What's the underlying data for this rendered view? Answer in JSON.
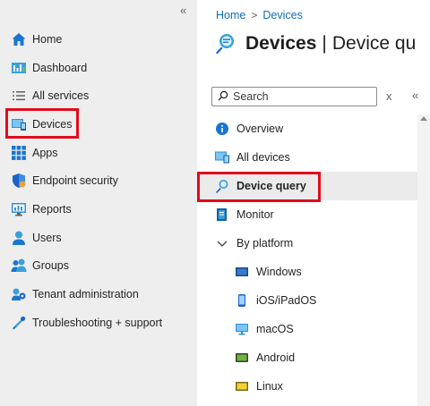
{
  "leftnav": {
    "collapse_icon": "double-chevron-left",
    "items": [
      {
        "label": "Home",
        "icon": "home-icon"
      },
      {
        "label": "Dashboard",
        "icon": "dashboard-icon"
      },
      {
        "label": "All services",
        "icon": "list-icon"
      },
      {
        "label": "Devices",
        "icon": "devices-icon"
      },
      {
        "label": "Apps",
        "icon": "apps-grid-icon"
      },
      {
        "label": "Endpoint security",
        "icon": "shield-icon"
      },
      {
        "label": "Reports",
        "icon": "reports-icon"
      },
      {
        "label": "Users",
        "icon": "user-icon"
      },
      {
        "label": "Groups",
        "icon": "groups-icon"
      },
      {
        "label": "Tenant administration",
        "icon": "tenant-gear-icon"
      },
      {
        "label": "Troubleshooting + support",
        "icon": "tools-icon"
      }
    ]
  },
  "breadcrumb": {
    "home": "Home",
    "separator": ">",
    "current": "Devices"
  },
  "page": {
    "title_bold": "Devices",
    "title_sep": "|",
    "title_rest": "Device qu"
  },
  "search": {
    "placeholder": "Search",
    "clear": "x",
    "collapse": "«"
  },
  "menu": {
    "items": [
      {
        "label": "Overview",
        "icon": "info-icon"
      },
      {
        "label": "All devices",
        "icon": "all-devices-icon"
      },
      {
        "label": "Device query",
        "icon": "device-query-icon",
        "selected": true
      },
      {
        "label": "Monitor",
        "icon": "monitor-book-icon"
      },
      {
        "label": "By platform",
        "icon": "chevron-down-icon"
      },
      {
        "label": "Windows",
        "icon": "windows-icon"
      },
      {
        "label": "iOS/iPadOS",
        "icon": "phone-icon"
      },
      {
        "label": "macOS",
        "icon": "desktop-icon"
      },
      {
        "label": "Android",
        "icon": "android-icon"
      },
      {
        "label": "Linux",
        "icon": "linux-icon"
      }
    ]
  },
  "colors": {
    "accent": "#0f6cbd",
    "highlight": "#e00b1c",
    "nav_bg": "#eeeeee"
  }
}
